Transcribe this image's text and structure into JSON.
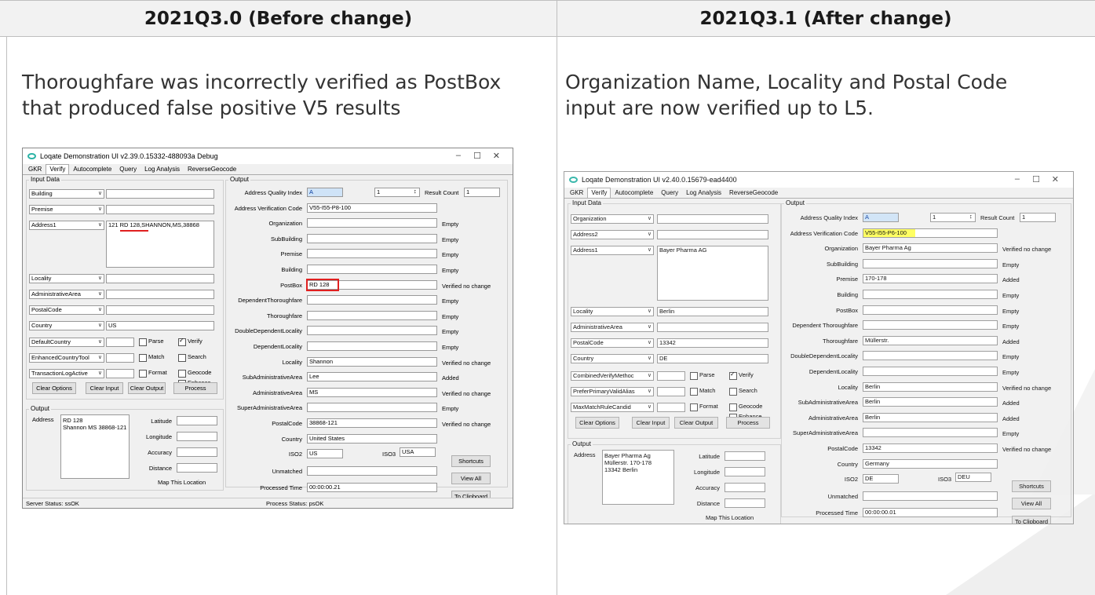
{
  "headers": {
    "before": "2021Q3.0 (Before change)",
    "after": "2021Q3.1 (After change)"
  },
  "descriptions": {
    "before_line1": "Thoroughfare was incorrectly verified as PostBox",
    "before_line2": "that produced false positive V5 results",
    "after_line1": "Organization Name, Locality and Postal Code",
    "after_line2": "input are now verified up to L5."
  },
  "left_window": {
    "title": "Loqate Demonstration UI v2.39.0.15332-488093a Debug",
    "tabs": [
      "GKR",
      "Verify",
      "Autocomplete",
      "Query",
      "Log Analysis",
      "ReverseGeocode"
    ],
    "input_data_label": "Input Data",
    "fields": [
      {
        "dd": "Building",
        "val": ""
      },
      {
        "dd": "Premise",
        "val": ""
      },
      {
        "dd": "Address1",
        "val": "121 RD 128,SHANNON,MS,38868"
      },
      {
        "dd": "Locality",
        "val": ""
      },
      {
        "dd": "AdministrativeArea",
        "val": ""
      },
      {
        "dd": "PostalCode",
        "val": ""
      },
      {
        "dd": "Country",
        "val": "US"
      }
    ],
    "options": [
      {
        "dd": "DefaultCountry",
        "cb1": "Parse",
        "cb2": "Verify"
      },
      {
        "dd": "EnhancedCountryTool",
        "cb1": "Match",
        "cb2": "Search"
      },
      {
        "dd": "TransactionLogActive",
        "cb1": "Format",
        "cb2": "Geocode"
      }
    ],
    "enhance": "Enhance",
    "buttons": [
      "Clear Options",
      "Clear Input",
      "Clear Output",
      "Process"
    ],
    "output_label": "Output",
    "address_label": "Address",
    "address_value": "RD 128\nShannon MS 38868-121",
    "geo": [
      "Latitude",
      "Longitude",
      "Accuracy",
      "Distance"
    ],
    "map_link": "Map This Location",
    "aqi_label": "Address Quality Index",
    "aqi_value": "A",
    "spin_value": "1",
    "result_count_label": "Result Count",
    "result_count_value": "1",
    "avc_label": "Address Verification Code",
    "avc_value": "V55-I55-P8-100",
    "rows": [
      {
        "label": "Organization",
        "val": "",
        "status": "Empty"
      },
      {
        "label": "SubBuilding",
        "val": "",
        "status": "Empty"
      },
      {
        "label": "Premise",
        "val": "",
        "status": "Empty"
      },
      {
        "label": "Building",
        "val": "",
        "status": "Empty"
      },
      {
        "label": "PostBox",
        "val": "RD 128",
        "status": "Verified no change"
      },
      {
        "label": "DependentThoroughfare",
        "val": "",
        "status": "Empty"
      },
      {
        "label": "Thoroughfare",
        "val": "",
        "status": "Empty"
      },
      {
        "label": "DoubleDependentLocality",
        "val": "",
        "status": "Empty"
      },
      {
        "label": "DependentLocality",
        "val": "",
        "status": "Empty"
      },
      {
        "label": "Locality",
        "val": "Shannon",
        "status": "Verified no change"
      },
      {
        "label": "SubAdministrativeArea",
        "val": "Lee",
        "status": "Added"
      },
      {
        "label": "AdministrativeArea",
        "val": "MS",
        "status": "Verified no change"
      },
      {
        "label": "SuperAdministrativeArea",
        "val": "",
        "status": "Empty"
      },
      {
        "label": "PostalCode",
        "val": "38868-121",
        "status": "Verified no change"
      },
      {
        "label": "Country",
        "val": "United States",
        "status": ""
      }
    ],
    "iso2_label": "ISO2",
    "iso2_value": "US",
    "iso3_label": "ISO3",
    "iso3_value": "USA",
    "unmatched_label": "Unmatched",
    "processed_label": "Processed Time",
    "processed_value": "00:00:00.21",
    "side_buttons": [
      "Shortcuts",
      "View All",
      "To Clipboard"
    ],
    "server_status": "Server Status: ssOK",
    "process_status": "Process Status: psOK"
  },
  "right_window": {
    "title": "Loqate Demonstration UI v2.40.0.15679-ead4400",
    "tabs": [
      "GKR",
      "Verify",
      "Autocomplete",
      "Query",
      "Log Analysis",
      "ReverseGeocode"
    ],
    "input_data_label": "Input Data",
    "fields": [
      {
        "dd": "Organization",
        "val": ""
      },
      {
        "dd": "Address2",
        "val": ""
      },
      {
        "dd": "Address1",
        "val": "Bayer Pharma AG"
      },
      {
        "dd": "Locality",
        "val": "Berlin"
      },
      {
        "dd": "AdministrativeArea",
        "val": ""
      },
      {
        "dd": "PostalCode",
        "val": "13342"
      },
      {
        "dd": "Country",
        "val": "DE"
      }
    ],
    "options": [
      {
        "dd": "CombinedVerifyMethoc",
        "cb1": "Parse",
        "cb2": "Verify"
      },
      {
        "dd": "PreferPrimaryValidAlias",
        "cb1": "Match",
        "cb2": "Search"
      },
      {
        "dd": "MaxMatchRuleCandid",
        "cb1": "Format",
        "cb2": "Geocode"
      }
    ],
    "enhance": "Enhance",
    "buttons": [
      "Clear Options",
      "Clear Input",
      "Clear Output",
      "Process"
    ],
    "output_label": "Output",
    "address_label": "Address",
    "address_value": "Bayer Pharma Ag\nMüllerstr. 170-178\n13342 Berlin",
    "geo": [
      "Latitude",
      "Longitude",
      "Accuracy",
      "Distance"
    ],
    "map_link": "Map This Location",
    "aqi_label": "Address Quality Index",
    "aqi_value": "A",
    "spin_value": "1",
    "result_count_label": "Result Count",
    "result_count_value": "1",
    "avc_label": "Address Verification Code",
    "avc_value": "V55-I55-P6-100",
    "rows": [
      {
        "label": "Organization",
        "val": "Bayer Pharma Ag",
        "status": "Verified no change"
      },
      {
        "label": "SubBuilding",
        "val": "",
        "status": "Empty"
      },
      {
        "label": "Premise",
        "val": "170-178",
        "status": "Added"
      },
      {
        "label": "Building",
        "val": "",
        "status": "Empty"
      },
      {
        "label": "PostBox",
        "val": "",
        "status": "Empty"
      },
      {
        "label": "Dependent Thoroughfare",
        "val": "",
        "status": "Empty"
      },
      {
        "label": "Thoroughfare",
        "val": "Müllerstr.",
        "status": "Added"
      },
      {
        "label": "DoubleDependentLocality",
        "val": "",
        "status": "Empty"
      },
      {
        "label": "DependentLocality",
        "val": "",
        "status": "Empty"
      },
      {
        "label": "Locality",
        "val": "Berlin",
        "status": "Verified no change"
      },
      {
        "label": "SubAdministrativeArea",
        "val": "Berlin",
        "status": "Added"
      },
      {
        "label": "AdministrativeArea",
        "val": "Berlin",
        "status": "Added"
      },
      {
        "label": "SuperAdministrativeArea",
        "val": "",
        "status": "Empty"
      },
      {
        "label": "PostalCode",
        "val": "13342",
        "status": "Verified no change"
      },
      {
        "label": "Country",
        "val": "Germany",
        "status": ""
      }
    ],
    "iso2_label": "ISO2",
    "iso2_value": "DE",
    "iso3_label": "ISO3",
    "iso3_value": "DEU",
    "unmatched_label": "Unmatched",
    "processed_label": "Processed Time",
    "processed_value": "00:00:00.01",
    "side_buttons": [
      "Shortcuts",
      "View All",
      "To Clipboard"
    ]
  }
}
